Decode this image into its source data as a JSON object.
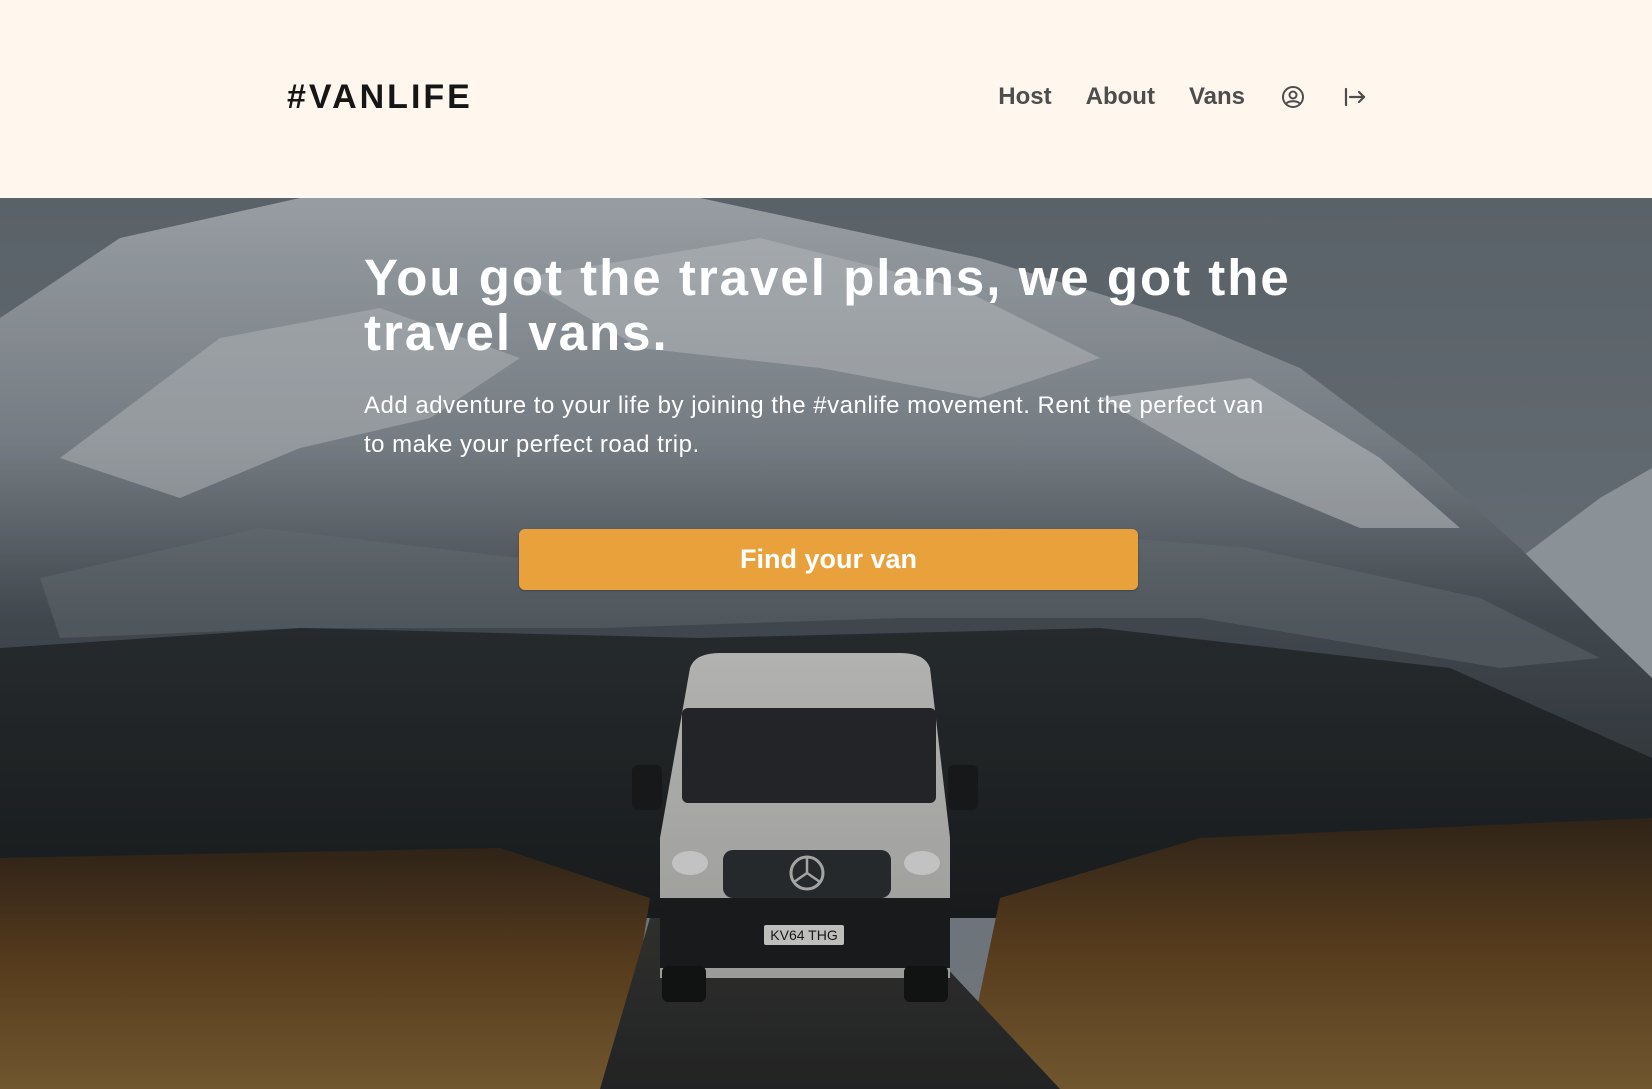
{
  "header": {
    "logo": "#VANLIFE",
    "nav": [
      {
        "label": "Host"
      },
      {
        "label": "About"
      },
      {
        "label": "Vans"
      }
    ],
    "icons": [
      "user-circle-icon",
      "logout-arrow-icon"
    ]
  },
  "hero": {
    "title": "You got the travel plans, we got the travel vans.",
    "subtitle": "Add adventure to your life by joining the #vanlife movement. Rent the perfect van to make your perfect road trip.",
    "cta_label": "Find your van",
    "license_plate": "KV64 THG"
  },
  "colors": {
    "header_bg": "#FFF7ED",
    "logo": "#161616",
    "nav_link": "#4D4D4D",
    "cta_bg": "#E9A23B",
    "hero_text": "#FFFFFF"
  }
}
